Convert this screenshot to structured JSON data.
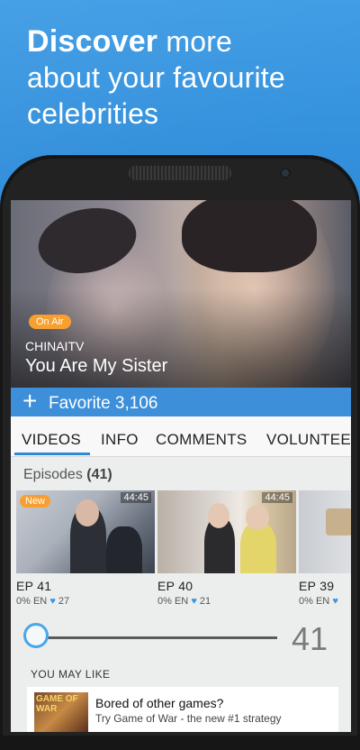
{
  "promo": {
    "headline_bold": "Discover",
    "headline_rest_1": " more",
    "headline_line_2": "about your favourite",
    "headline_line_3": "celebrities"
  },
  "hero": {
    "badge": "On Air",
    "channel": "CHINAITV",
    "title": "You Are My Sister"
  },
  "favorite": {
    "icon": "plus-icon",
    "label": "Favorite",
    "count": "3,106"
  },
  "tabs": [
    {
      "label": "VIDEOS",
      "active": true
    },
    {
      "label": "INFO"
    },
    {
      "label": "COMMENTS"
    },
    {
      "label": "VOLUNTEE"
    }
  ],
  "episodes": {
    "label": "Episodes",
    "count": "(41)",
    "items": [
      {
        "duration": "44:45",
        "badge": "New",
        "title": "EP 41",
        "subs": "0% EN",
        "likes": "27"
      },
      {
        "duration": "44:45",
        "title": "EP 40",
        "subs": "0% EN",
        "likes": "21"
      },
      {
        "title": "EP 39",
        "subs": "0% EN",
        "likes": ""
      }
    ],
    "heart_icon": "heart-icon",
    "heart_color": "#3b97e0"
  },
  "slider": {
    "value": "41"
  },
  "recommend": {
    "heading": "YOU MAY LIKE",
    "ad_image_text": "GAME OF WAR",
    "ad_title": "Bored of other games?",
    "ad_subtitle": "Try Game of War - the new #1 strategy"
  },
  "colors": {
    "background": "#2b86d4",
    "accent_blue": "#3d8fd9",
    "badge_orange": "#f7a030"
  }
}
